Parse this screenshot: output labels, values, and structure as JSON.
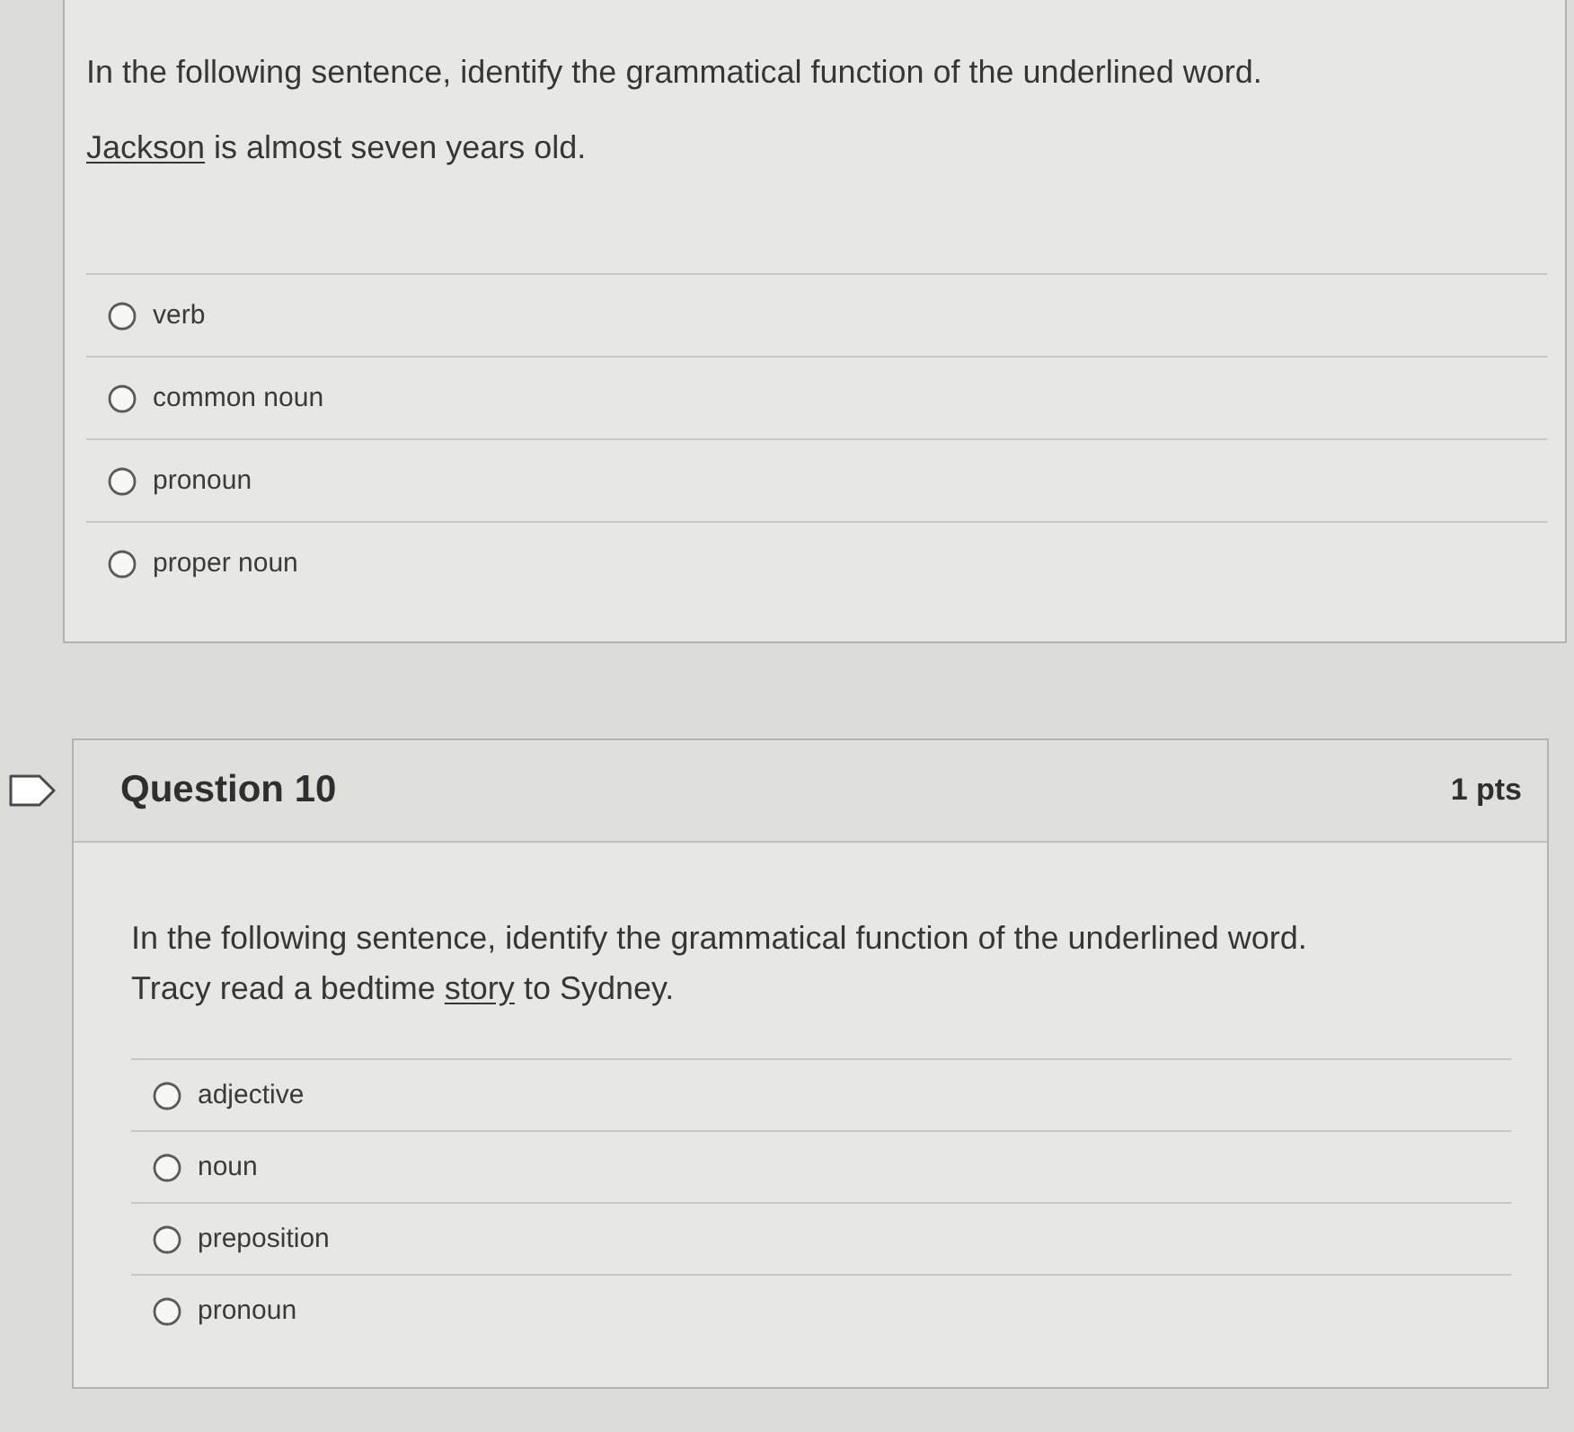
{
  "questions": [
    {
      "prompt": "In the following sentence, identify the grammatical function of the underlined word.",
      "sentence": [
        {
          "text": "Jackson",
          "underlined": true
        },
        {
          "text": " is almost seven years old.",
          "underlined": false
        }
      ],
      "options": [
        {
          "label": "verb",
          "selected": false
        },
        {
          "label": "common noun",
          "selected": false
        },
        {
          "label": "pronoun",
          "selected": false
        },
        {
          "label": "proper noun",
          "selected": false
        }
      ]
    },
    {
      "header": {
        "title": "Question 10",
        "points": "1 pts",
        "flagged": false
      },
      "prompt": "In the following sentence, identify the grammatical function of the underlined word.",
      "sentence": [
        {
          "text": "Tracy read a bedtime ",
          "underlined": false
        },
        {
          "text": "story",
          "underlined": true
        },
        {
          "text": " to Sydney.",
          "underlined": false
        }
      ],
      "options": [
        {
          "label": "adjective",
          "selected": false
        },
        {
          "label": "noun",
          "selected": false
        },
        {
          "label": "preposition",
          "selected": false
        },
        {
          "label": "pronoun",
          "selected": false
        }
      ]
    }
  ]
}
